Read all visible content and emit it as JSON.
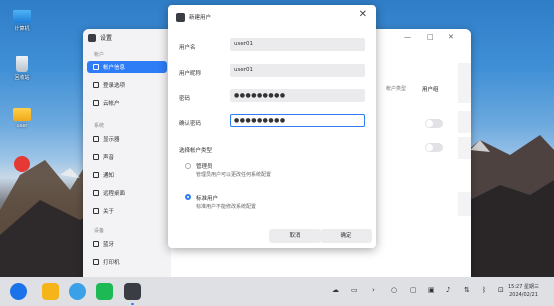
{
  "desktop": {
    "icons": [
      {
        "label": "计算机"
      },
      {
        "label": "回收站"
      },
      {
        "label": "user"
      },
      {
        "label": ""
      }
    ]
  },
  "settings": {
    "title": "设置",
    "groups": [
      "帐户",
      "系统",
      "设备"
    ],
    "items": [
      {
        "label": "帐户信息"
      },
      {
        "label": "登录选项"
      },
      {
        "label": "云帐户"
      },
      {
        "label": "显示器"
      },
      {
        "label": "声音"
      },
      {
        "label": "通知"
      },
      {
        "label": "远程桌面"
      },
      {
        "label": "关于"
      },
      {
        "label": "蓝牙"
      },
      {
        "label": "打印机"
      }
    ],
    "table_header_left": "帐户类型",
    "table_header_right": "用户组"
  },
  "dialog": {
    "title": "新建用户",
    "close": "✕",
    "username_label": "用户名",
    "username_value": "user01",
    "fullname_label": "用户昵称",
    "fullname_value": "user01",
    "password_label": "密码",
    "password_value": "●●●●●●●●●",
    "confirm_label": "确认密码",
    "confirm_value": "●●●●●●●●●",
    "type_section": "选择帐户类型",
    "admin_title": "管理员",
    "admin_desc": "管理员用户可以更改任何系统配置",
    "standard_title": "标准用户",
    "standard_desc": "标准用户不能修改系统配置",
    "selected_type": "standard",
    "cancel": "取消",
    "ok": "确定"
  },
  "taskbar": {
    "time": "15:27 星期三",
    "date": "2024/02/21",
    "tray_arrow": "›",
    "tray_icons": [
      "cloud-icon",
      "window-icon",
      "search-icon",
      "screen-icon",
      "display-icon",
      "volume-icon",
      "network-icon",
      "bluetooth-icon",
      "notification-icon"
    ]
  },
  "colors": {
    "accent": "#2e7cf6",
    "sidebar": "#f3f3f5",
    "taskbar": "#e6e8ec"
  }
}
